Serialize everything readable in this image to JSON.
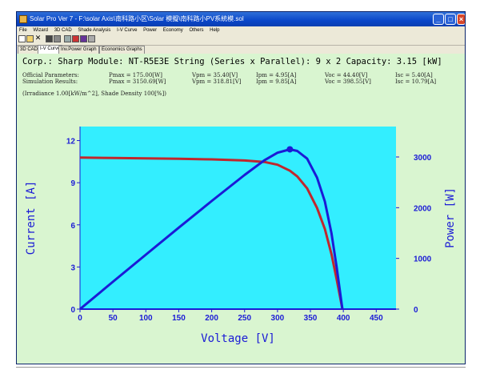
{
  "window": {
    "title": "Solar Pro Ver 7 - F:\\solar Axis\\南科路小区\\Solar 模擬\\南科路小PV系統模.sol",
    "buttons": {
      "minimize": "_",
      "maximize": "□",
      "close": "×"
    }
  },
  "menu": [
    "File",
    "Wizard",
    "3D CAD",
    "Shade Analysis",
    "I-V Curve",
    "Power",
    "Economy",
    "Others",
    "Help"
  ],
  "toolbar": {
    "icons": [
      "new-icon",
      "open-icon",
      "cut-icon",
      "save-icon",
      "print-icon",
      "chart-icon",
      "color-icon",
      "photo-icon",
      "window-icon"
    ]
  },
  "tabs": [
    "3D CAD",
    "I-V Curve",
    "Inv.Power Graph",
    "Economics Graphs"
  ],
  "active_tab": "I-V Curve",
  "header": "Corp.: Sharp  Module: NT-R5E3E  String (Series x Parallel): 9 x 2  Capacity: 3.15 [kW]",
  "params": {
    "official_label": "Official Parameters:",
    "simulation_label": "Simulation Results:",
    "official": [
      "Pmax = 175.00[W]",
      "Vpm = 35.40[V]",
      "Ipm = 4.95[A]",
      "Voc = 44.40[V]",
      "Isc = 5.40[A]"
    ],
    "simulation": [
      "Pmax = 3150.69[W]",
      "Vpm = 318.81[V]",
      "Ipm = 9.85[A]",
      "Voc = 398.55[V]",
      "Isc = 10.79[A]"
    ]
  },
  "irradiance": "(Irradiance 1.00[kW/m^2], Shade Density 100[%])",
  "chart_data": {
    "type": "line",
    "title": "",
    "xlabel": "Voltage [V]",
    "ylabel": "Current [A]",
    "y2label": "Power [W]",
    "xlim": [
      0,
      480
    ],
    "ylim": [
      0,
      13
    ],
    "y2lim": [
      0,
      3600
    ],
    "xticks": [
      0,
      50,
      100,
      150,
      200,
      250,
      300,
      350,
      400,
      450
    ],
    "yticks": [
      0,
      3,
      6,
      9,
      12
    ],
    "y2ticks": [
      0,
      1000,
      2000,
      3000
    ],
    "grid": false,
    "background": "#33eeff",
    "series": [
      {
        "color": "#c0272d",
        "axis": "left",
        "x": [
          0,
          50,
          100,
          150,
          200,
          250,
          280,
          300,
          318.81,
          330,
          345,
          360,
          372,
          382,
          390,
          398.55
        ],
        "y": [
          10.79,
          10.76,
          10.73,
          10.7,
          10.66,
          10.58,
          10.48,
          10.28,
          9.85,
          9.45,
          8.6,
          7.2,
          5.7,
          3.9,
          2.1,
          0
        ]
      },
      {
        "color": "#1b1bd6",
        "axis": "right",
        "x": [
          0,
          50,
          100,
          150,
          200,
          250,
          280,
          300,
          318.81,
          330,
          345,
          360,
          372,
          382,
          390,
          398.55
        ],
        "y": [
          0,
          538,
          1073,
          1605,
          2132,
          2645,
          2934,
          3084,
          3150.69,
          3119,
          2967,
          2592,
          2120,
          1490,
          819,
          0
        ]
      }
    ],
    "marker": {
      "x": 318.81,
      "y": 3150.69,
      "axis": "right",
      "color": "#1b1bd6"
    }
  }
}
